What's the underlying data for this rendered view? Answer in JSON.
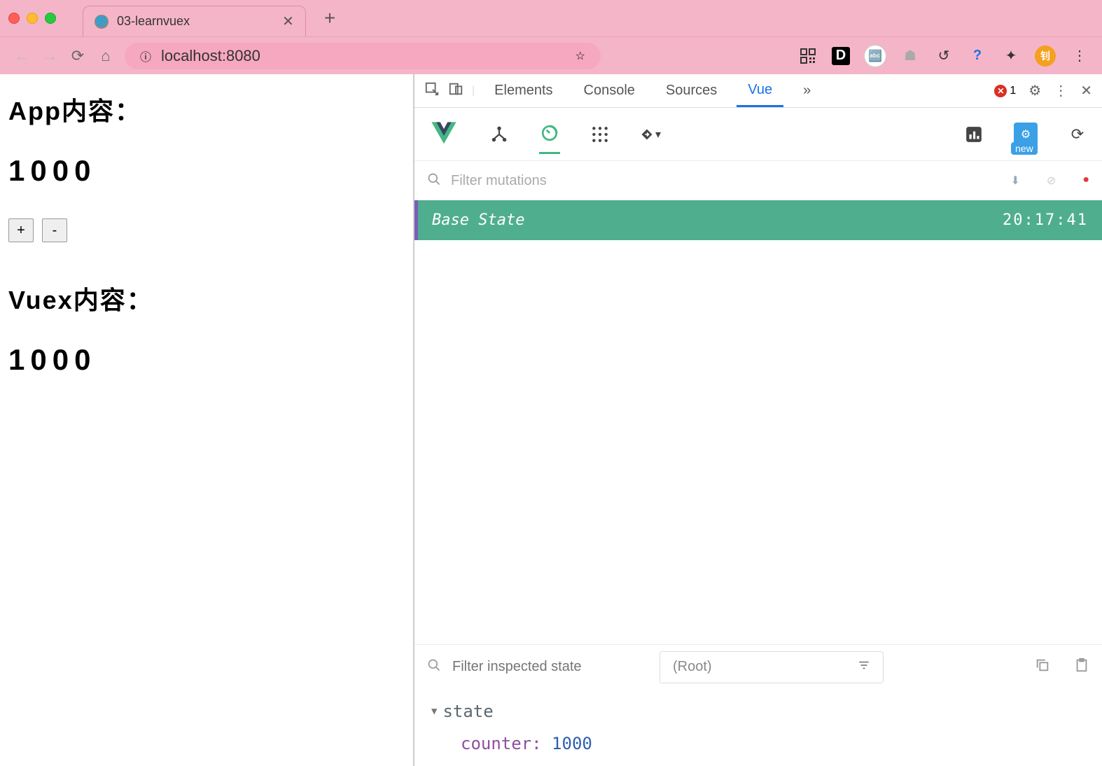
{
  "tab": {
    "title": "03-learnvuex"
  },
  "url": {
    "value": "localhost:8080"
  },
  "page": {
    "app_heading": "App内容：",
    "app_value": "1000",
    "btn_plus": "+",
    "btn_minus": "-",
    "vuex_heading": "Vuex内容：",
    "vuex_value": "1000"
  },
  "devtools": {
    "tabs": {
      "elements": "Elements",
      "console": "Console",
      "sources": "Sources",
      "vue": "Vue",
      "more": "»"
    },
    "error_count": "1",
    "filter_mutations_placeholder": "Filter mutations",
    "mutations": [
      {
        "label": "Base State",
        "time": "20:17:41"
      }
    ],
    "filter_state_placeholder": "Filter inspected state",
    "root_label": "(Root)",
    "settings_new": "new",
    "state": {
      "label": "state",
      "prop_name": "counter:",
      "prop_value": "1000"
    }
  },
  "avatar_initial": "钊"
}
